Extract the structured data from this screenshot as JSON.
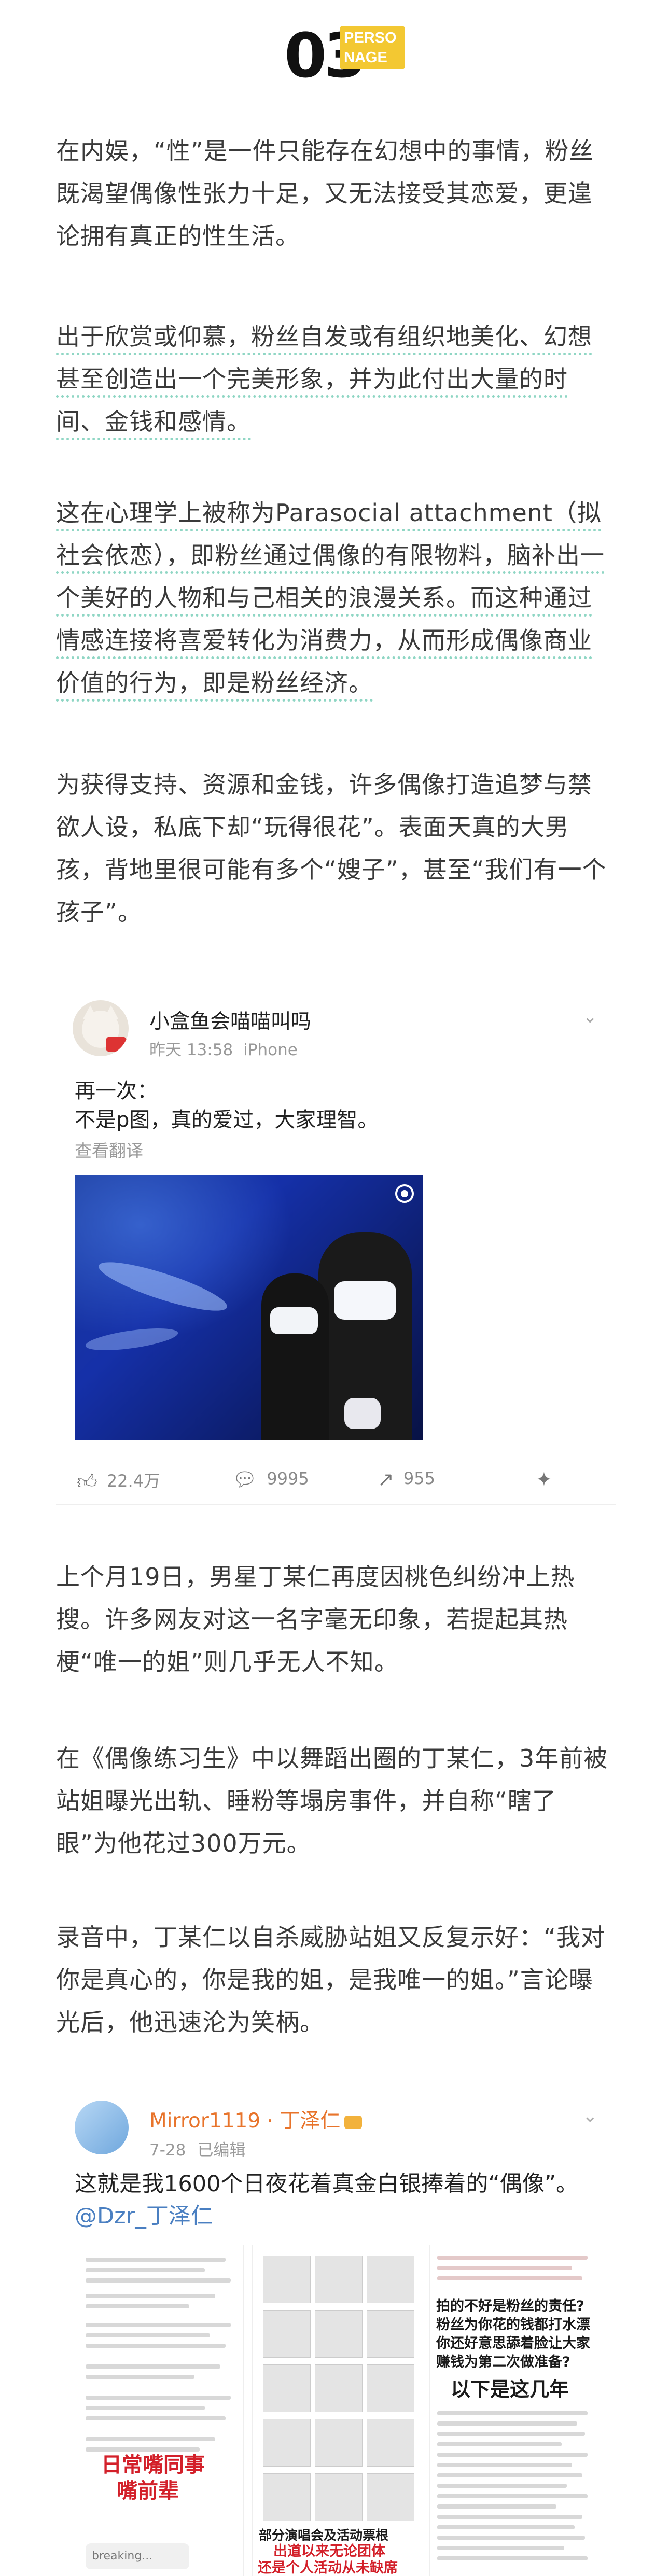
{
  "section": {
    "number": "03",
    "badge_line1": "PERSO",
    "badge_line2": "NAGE"
  },
  "paragraphs": [
    "在内娱，“性”是一件只能存在幻想中的事情，粉丝既渴望偶像性张力十足，又无法接受其恋爱，更遑论拥有真正的性生活。",
    "出于欣赏或仰慕，粉丝自发或有组织地美化、幻想甚至创造出一个完美形象，并为此付出大量的时间、金钱和感情。",
    "这在心理学上被称为Parasocial attachment（拟社会依恋），即粉丝通过偶像的有限物料，脑补出一个美好的人物和与己相关的浪漫关系。而这种通过情感连接将喜爱转化为消费力，从而形成偶像商业价值的行为，即是粉丝经济。",
    "为获得支持、资源和金钱，许多偶像打造追梦与禁欲人设，私底下却“玩得很花”。表面天真的大男孩，背地里很可能有多个“嫂子”，甚至“我们有一个孩子”。",
    "上个月19日，男星丁某仁再度因桃色纠纷冲上热搜。许多网友对这一名字毫无印象，若提起其热梗“唯一的姐”则几乎无人不知。",
    "在《偶像练习生》中以舞蹈出圈的丁某仁，3年前被站姐曝光出轨、睡粉等塌房事件，并自称“瞎了眼”为他花过300万元。",
    "录音中，丁某仁以自杀威胁站姐又反复示好：“我对你是真心的，你是我的姐，是我唯一的姐。”言论曝光后，他迅速沦为笑柄。"
  ],
  "weibo_post": {
    "user_name": "小盒鱼会喵喵叫吗",
    "time": "昨天 13:58",
    "device": "iPhone",
    "text": "再一次：\n不是p图，真的爱过，大家理智。",
    "translate_label": "查看翻译",
    "likes": "22.4万",
    "comments": "9995",
    "reposts": "955",
    "icons": [
      "like-icon",
      "comment-icon",
      "repost-icon",
      "share-icon"
    ]
  },
  "post_card": {
    "user_name": "Mirror1119 · 丁泽仁",
    "date": "7-28",
    "edited": "已编辑",
    "text_main": "这就是我1600个日夜花着真金白银捧着的“偶像”。",
    "mention": "@Dzr_丁泽仁",
    "image1_caption1": "日常嘴同事",
    "image1_caption2": "嘴前辈",
    "image2_caption1": "部分演唱会及活动票根",
    "image2_caption2": "出道以来无论团体",
    "image2_caption3": "还是个人活动从未缺席",
    "image3_heading1": "拍的不好是粉丝的责任?",
    "image3_heading2": "粉丝为你花的钱都打水漂",
    "image3_heading3": "你还好意思舔着脸让大家",
    "image3_heading4": "赚钱为第二次做准备?",
    "image3_footer": "以下是这几年",
    "image1_chat": "breaking..."
  },
  "colors": {
    "badge": "#f3c832",
    "highlight_underline": "#8fd6c4",
    "weibo_orange": "#e8742b",
    "mention_blue": "#4a7fc1",
    "emphasis_red": "#d3202a"
  }
}
